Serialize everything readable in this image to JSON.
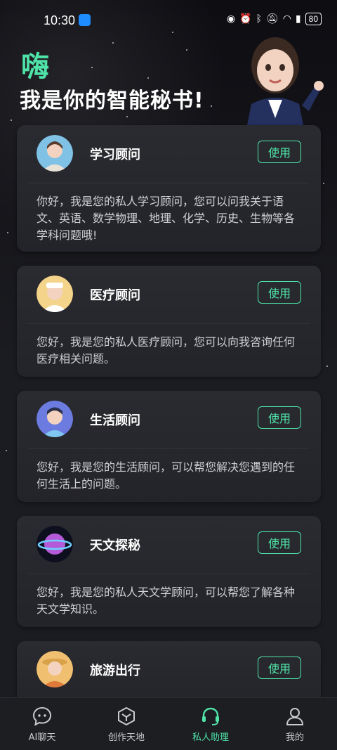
{
  "status": {
    "time": "10:30",
    "battery": "80"
  },
  "header": {
    "greet": "嗨",
    "headline": "我是你的智能秘书!"
  },
  "cards": [
    {
      "title": "学习顾问",
      "button": "使用",
      "desc": "你好，我是您的私人学习顾问，您可以问我关于语文、英语、数学物理、地理、化学、历史、生物等各学科问题哦!"
    },
    {
      "title": "医疗顾问",
      "button": "使用",
      "desc": "您好，我是您的私人医疗顾问，您可以向我咨询任何医疗相关问题。"
    },
    {
      "title": "生活顾问",
      "button": "使用",
      "desc": "您好，我是您的生活顾问，可以帮您解决您遇到的任何生活上的问题。"
    },
    {
      "title": "天文探秘",
      "button": "使用",
      "desc": "您好，我是您的私人天文学顾问，可以帮您了解各种天文学知识。"
    },
    {
      "title": "旅游出行",
      "button": "使用",
      "desc": ""
    }
  ],
  "nav": {
    "items": [
      {
        "label": "AI聊天",
        "icon": "chat-bubble-icon"
      },
      {
        "label": "创作天地",
        "icon": "cube-icon"
      },
      {
        "label": "私人助理",
        "icon": "headset-icon"
      },
      {
        "label": "我的",
        "icon": "person-icon"
      }
    ],
    "active_index": 2
  },
  "colors": {
    "accent": "#4fe3a8",
    "background": "#1b1c21",
    "card": "#2a2b30"
  }
}
